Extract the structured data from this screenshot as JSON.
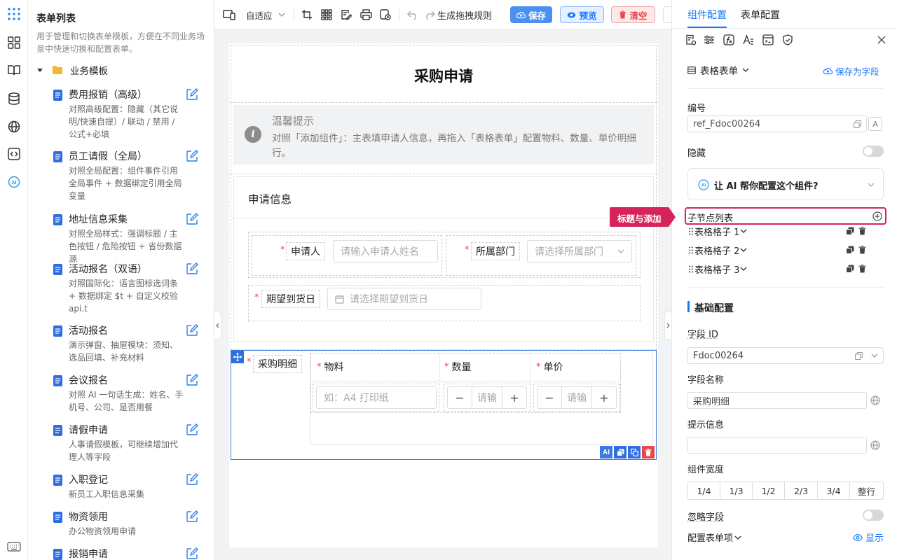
{
  "template_panel": {
    "title": "表单列表",
    "description": "用于管理和切换表单模板，方便在不同业务场景中快速切换和配置表单。",
    "folder": "业务模板",
    "items": [
      {
        "name": "费用报销（高级）",
        "desc": "对照高级配置：隐藏（其它说明/快速自提）/ 联动 / 禁用 / 公式+必填"
      },
      {
        "name": "员工请假（全局）",
        "desc": "对照全局配置：组件事件引用全局事件 + 数据绑定引用全局变量"
      },
      {
        "name": "地址信息采集",
        "desc": "对照全局样式：强调标题 / 主色按钮 / 危险按钮 + 省份数据源"
      },
      {
        "name": "活动报名（双语）",
        "desc": "对照国际化：语言图标选词条 + 数据绑定 $t + 自定义校验 api.t"
      },
      {
        "name": "活动报名",
        "desc": "演示弹窗、抽屉模块：须知、选品回填、补充材料"
      },
      {
        "name": "会议报名",
        "desc": "对照 AI 一句话生成：姓名、手机号、公司、是否用餐"
      },
      {
        "name": "请假申请",
        "desc": "人事请假模板，可继续增加代理人等字段"
      },
      {
        "name": "入职登记",
        "desc": "新员工入职信息采集"
      },
      {
        "name": "物资领用",
        "desc": "办公物资领用申请"
      },
      {
        "name": "报销申请",
        "desc": ""
      }
    ]
  },
  "toolbar": {
    "adaptive_label": "自适应",
    "generate_rules_label": "生成拖拽规则",
    "save_label": "保存",
    "preview_label": "预览",
    "clear_label": "清空"
  },
  "form": {
    "title": "采购申请",
    "tip_title": "温馨提示",
    "tip_text": "对照「添加组件」：主表填申请人信息，再拖入「表格表单」配置物料、数量、单价明细行。",
    "section_title": "申请信息",
    "applicant_label": "申请人",
    "applicant_placeholder": "请输入申请人姓名",
    "dept_label": "所属部门",
    "dept_placeholder": "请选择所属部门",
    "date_label": "期望到货日",
    "date_placeholder": "请选择期望到货日",
    "detail_label": "采购明细",
    "col_material": "物料",
    "col_qty": "数量",
    "col_price": "单价",
    "material_placeholder": "如：A4 打印纸",
    "qty_placeholder": "请输",
    "price_placeholder": "请输",
    "ai_chip": "AI"
  },
  "right_panel": {
    "tab_component": "组件配置",
    "tab_form": "表单配置",
    "component_type": "表格表单",
    "save_as_field": "保存为字段",
    "id_label": "编号",
    "id_value": "ref_Fdoc00264",
    "hidden_label": "隐藏",
    "ai_help": "让 AI 帮你配置这个组件?",
    "child_list_label": "子节点列表",
    "callout": "标题与添加",
    "children": [
      "表格格子 1",
      "表格格子 2",
      "表格格子 3"
    ],
    "basic_config": "基础配置",
    "field_id_label": "字段 ID",
    "field_id_value": "Fdoc00264",
    "field_name_label": "字段名称",
    "field_name_value": "采购明细",
    "hint_label": "提示信息",
    "hint_value": "",
    "width_label": "组件宽度",
    "width_options": [
      "1/4",
      "1/3",
      "1/2",
      "2/3",
      "3/4",
      "整行"
    ],
    "ignore_label": "忽略字段",
    "config_items_label": "配置表单项",
    "show_label": "显示"
  },
  "colors": {
    "accent": "#1677ff",
    "danger": "#e5484d",
    "callout": "#d6245a"
  }
}
